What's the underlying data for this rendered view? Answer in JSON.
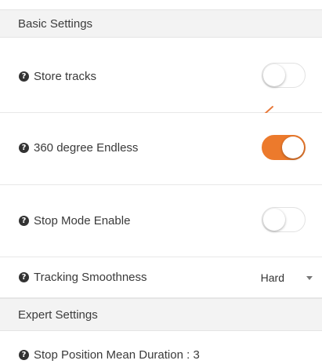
{
  "sections": {
    "basic_title": "Basic Settings",
    "expert_title": "Expert Settings"
  },
  "settings": {
    "store_tracks": {
      "label": "Store tracks",
      "enabled": false
    },
    "endless_360": {
      "label": "360 degree Endless",
      "enabled": true
    },
    "stop_mode": {
      "label": "Stop Mode Enable",
      "enabled": false
    },
    "tracking_smoothness": {
      "label": "Tracking Smoothness",
      "value": "Hard"
    },
    "stop_position_mean_duration": {
      "label": "Stop Position Mean Duration : 3"
    }
  },
  "icons": {
    "help": "question-circle-icon",
    "annotation": "left-arrow-icon",
    "dropdown": "caret-down-icon"
  },
  "colors": {
    "accent": "#ec7a2c",
    "section_bg": "#f3f3f3",
    "annotation_arrow": "#e8793a"
  }
}
